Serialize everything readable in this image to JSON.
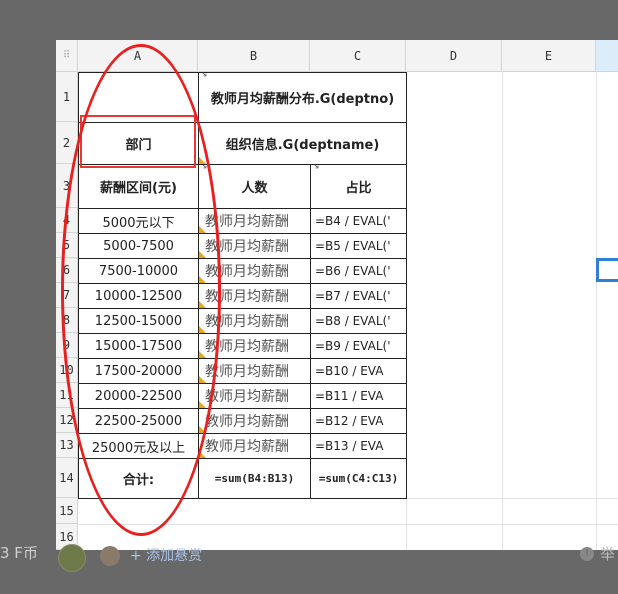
{
  "spreadsheet": {
    "corner_glyph": "⠿",
    "columns": [
      "A",
      "B",
      "C",
      "D",
      "E"
    ],
    "rows": [
      "1",
      "2",
      "3",
      "4",
      "5",
      "6",
      "7",
      "8",
      "9",
      "10",
      "11",
      "12",
      "13",
      "14",
      "15",
      "16"
    ],
    "header_row1": "教师月均薪酬分布.G(deptno)",
    "dept_label": "部门",
    "dept_value": "组织信息.G(deptname)",
    "header_range": "薪酬区间(元)",
    "header_count": "人数",
    "header_ratio": "占比",
    "data_rows": [
      {
        "range": "5000元以下",
        "count": "教师月均薪酬",
        "ratio": "=B4 / EVAL('"
      },
      {
        "range": "5000-7500",
        "count": "教师月均薪酬",
        "ratio": "=B5 / EVAL('"
      },
      {
        "range": "7500-10000",
        "count": "教师月均薪酬",
        "ratio": "=B6 / EVAL('"
      },
      {
        "range": "10000-12500",
        "count": "教师月均薪酬",
        "ratio": "=B7 / EVAL('"
      },
      {
        "range": "12500-15000",
        "count": "教师月均薪酬",
        "ratio": "=B8 / EVAL('"
      },
      {
        "range": "15000-17500",
        "count": "教师月均薪酬",
        "ratio": "=B9 / EVAL('"
      },
      {
        "range": "17500-20000",
        "count": "教师月均薪酬",
        "ratio": "=B10 / EVA"
      },
      {
        "range": "20000-22500",
        "count": "教师月均薪酬",
        "ratio": "=B11 / EVA"
      },
      {
        "range": "22500-25000",
        "count": "教师月均薪酬",
        "ratio": "=B12 / EVA"
      },
      {
        "range": "25000元及以上",
        "count": "教师月均薪酬",
        "ratio": "=B13 / EVA"
      }
    ],
    "total_label": "合计:",
    "total_count_formula": "=sum(B4:B13)",
    "total_ratio_formula": "=sum(C4:C13)"
  },
  "footer": {
    "coin_text": "3 F币",
    "add_link": "+ 添加悬赏",
    "right_text": "举"
  },
  "colors": {
    "annotation_red": "#e8201e",
    "selection_blue": "#2f80d1",
    "comment_marker": "#e7a81c"
  }
}
